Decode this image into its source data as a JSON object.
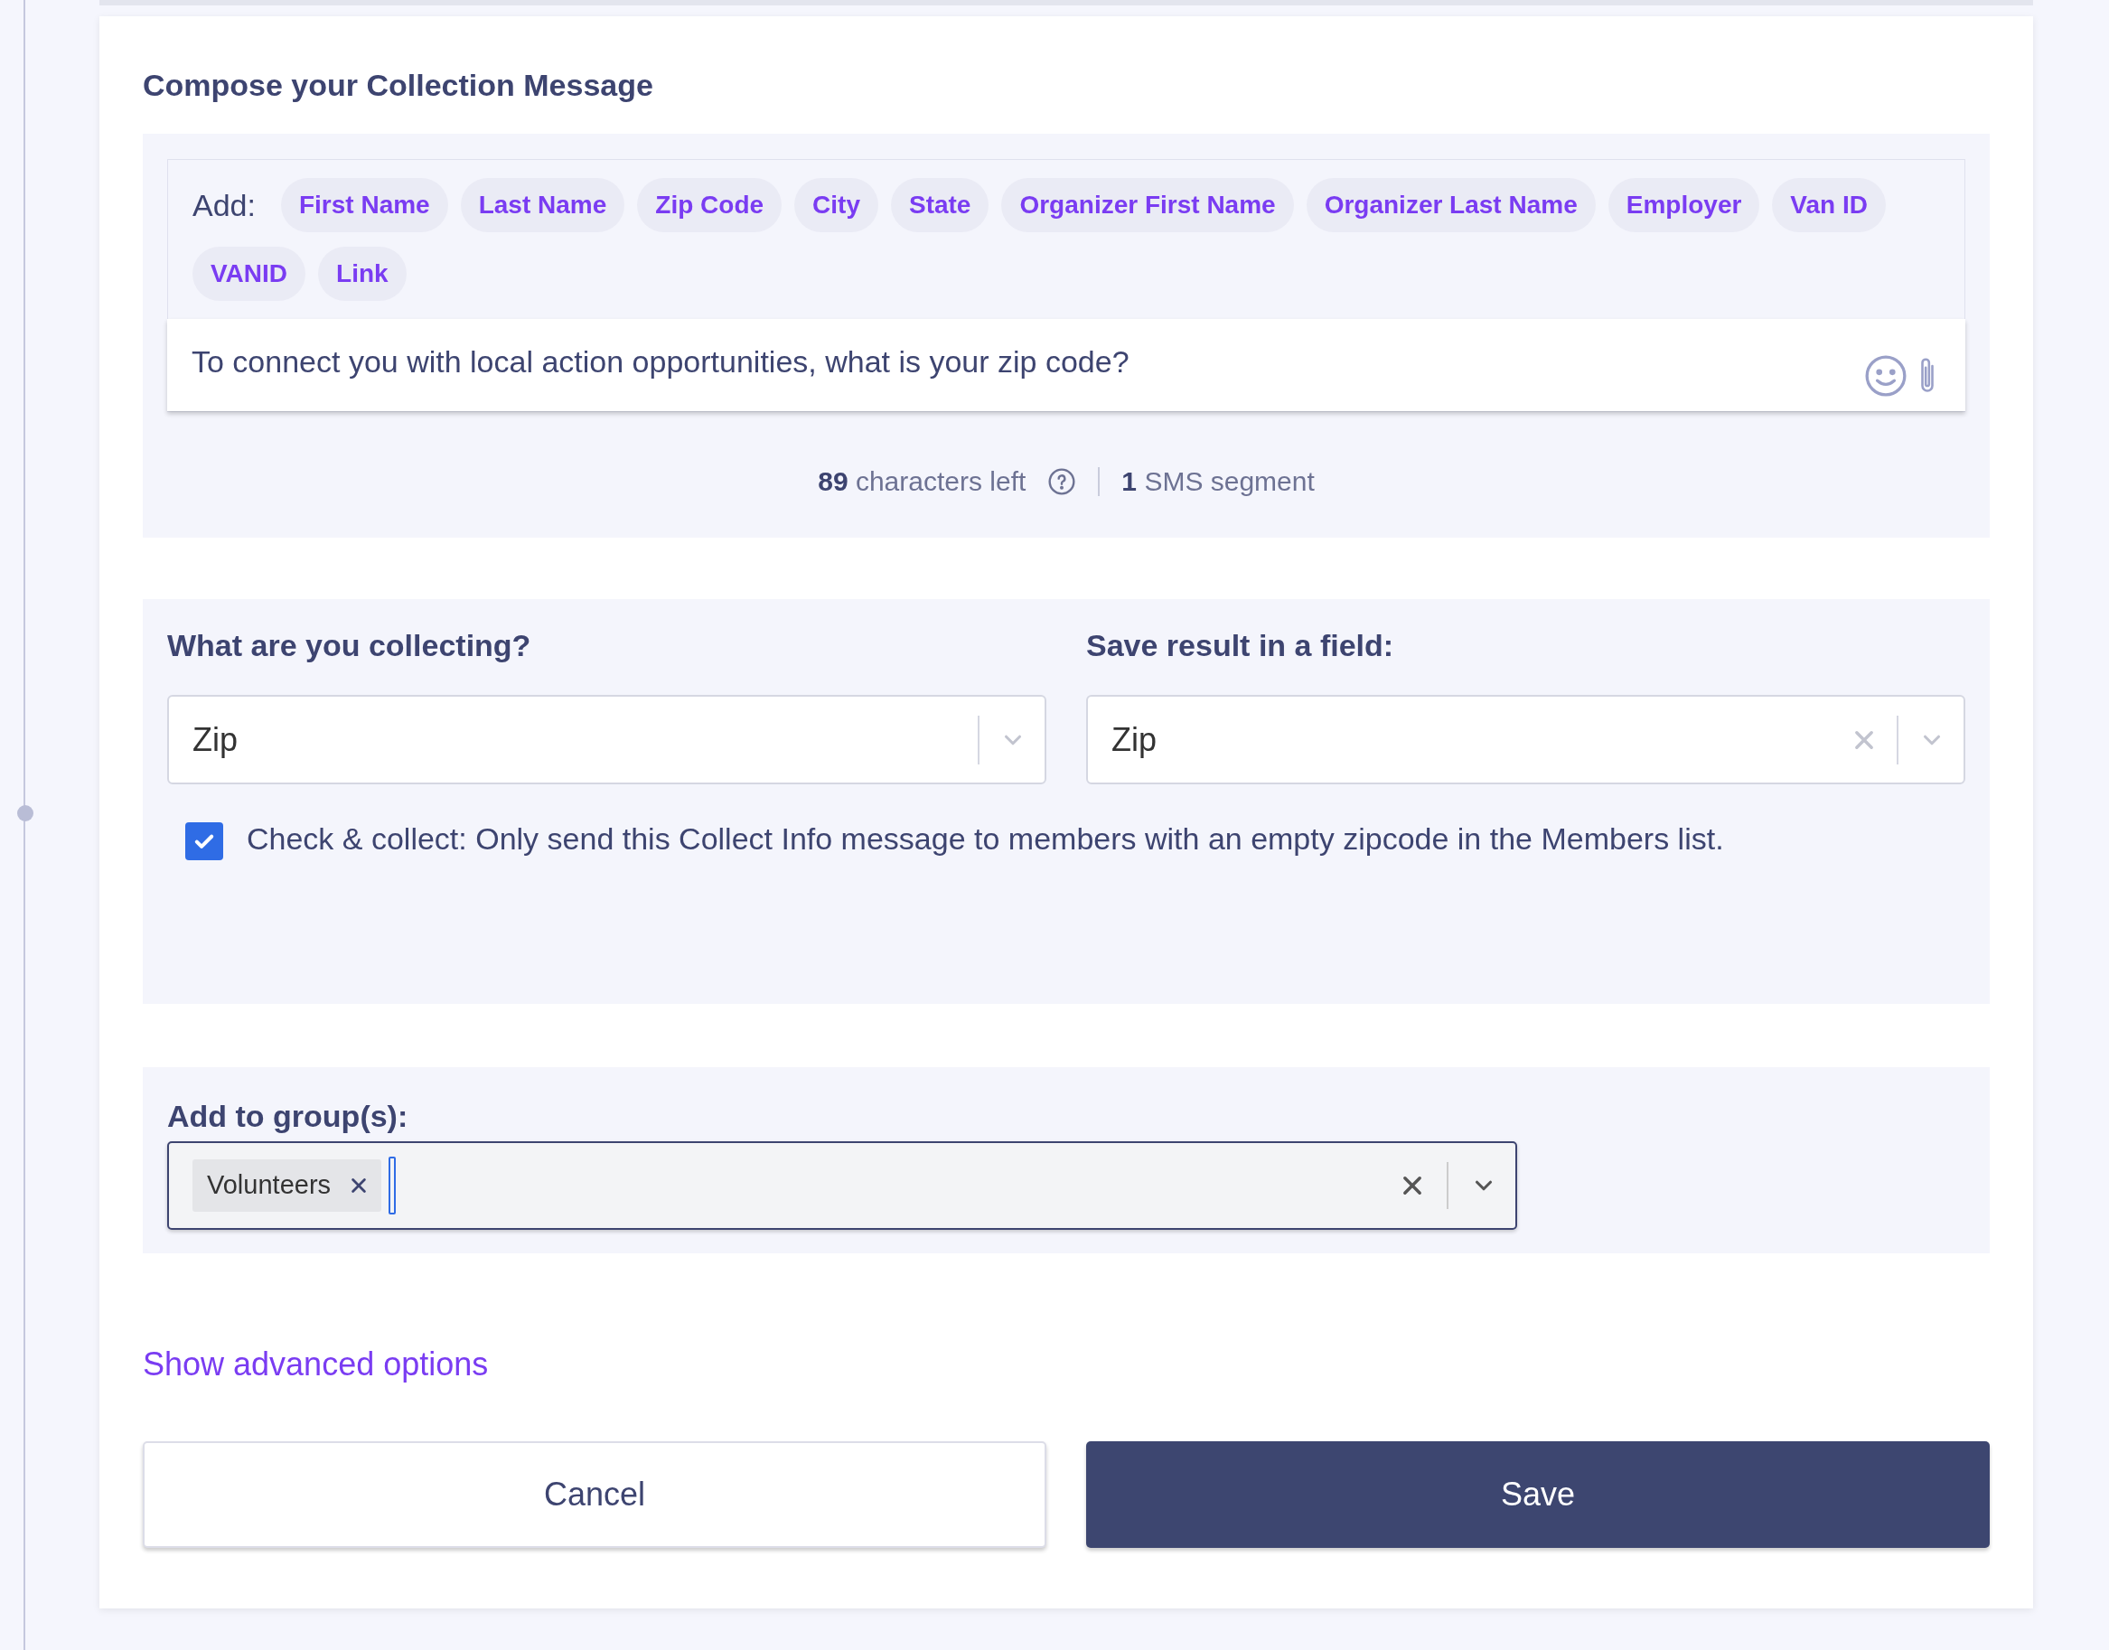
{
  "compose": {
    "title": "Compose your Collection Message",
    "add_label": "Add:",
    "tokens": [
      "First Name",
      "Last Name",
      "Zip Code",
      "City",
      "State",
      "Organizer First Name",
      "Organizer Last Name",
      "Employer",
      "Van ID",
      "VANID",
      "Link"
    ],
    "message": "To connect you with local action opportunities, what is your zip code?",
    "counter": {
      "chars": "89",
      "chars_label": "characters left",
      "segments": "1",
      "segments_label": "SMS segment"
    }
  },
  "collecting": {
    "label": "What are you collecting?",
    "value": "Zip"
  },
  "save_field": {
    "label": "Save result in a field:",
    "value": "Zip"
  },
  "check_collect": {
    "checked": true,
    "text": "Check & collect: Only send this Collect Info message to members with an empty zipcode in the Members list."
  },
  "groups": {
    "label": "Add to group(s):",
    "chips": [
      "Volunteers"
    ]
  },
  "advanced_link": "Show advanced options",
  "buttons": {
    "cancel": "Cancel",
    "save": "Save"
  }
}
